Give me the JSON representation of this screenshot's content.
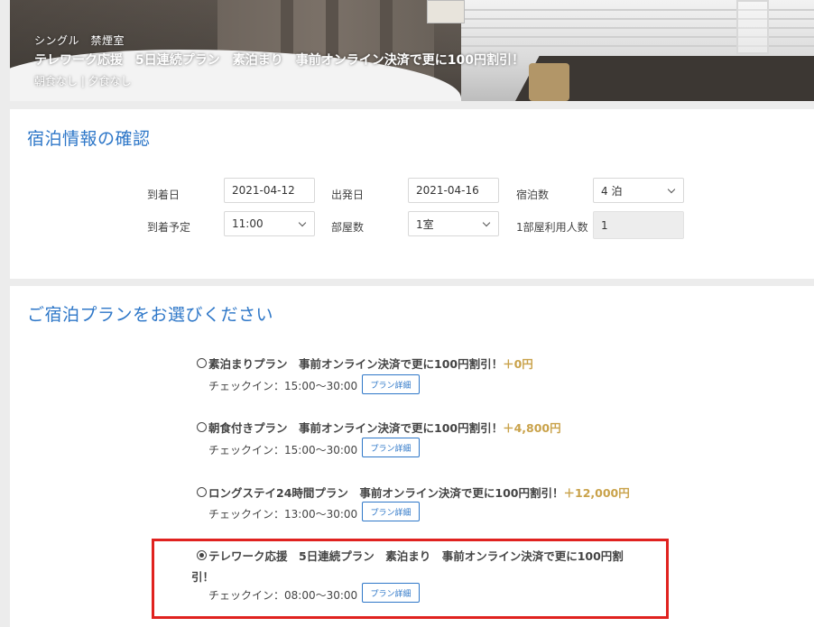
{
  "hero": {
    "room_type": "シングル　禁煙室",
    "plan_name": "テレワーク応援　5日連続プラン　素泊まり　事前オンライン決済で更に100円割引！",
    "meals": "朝食なし | 夕食なし"
  },
  "stay_info": {
    "title": "宿泊情報の確認",
    "arrival_date_label": "到着日",
    "arrival_date_value": "2021-04-12",
    "departure_date_label": "出発日",
    "departure_date_value": "2021-04-16",
    "nights_label": "宿泊数",
    "nights_value": "4 泊",
    "arrival_time_label": "到着予定",
    "arrival_time_value": "11:00",
    "rooms_label": "部屋数",
    "rooms_value": "1室",
    "guests_label": "1部屋利用人数",
    "guests_value": "1"
  },
  "plan_select": {
    "title": "ご宿泊プランをお選びください",
    "detail_label": "プラン詳細",
    "plans": [
      {
        "name": "素泊まりプラン　事前オンライン決済で更に100円割引！",
        "price": "＋0円",
        "checkin": "チェックイン：15:00～30:00",
        "selected": false
      },
      {
        "name": "朝食付きプラン　事前オンライン決済で更に100円割引！",
        "price": "＋4,800円",
        "checkin": "チェックイン：15:00～30:00",
        "selected": false
      },
      {
        "name": "ロングステイ24時間プラン　事前オンライン決済で更に100円割引！",
        "price": "＋12,000円",
        "checkin": "チェックイン：13:00～30:00",
        "selected": false
      },
      {
        "name_line1": "テレワーク応援　5日連続プラン　素泊まり　事前オンライン決済で更に100円割",
        "name_line2": "引！",
        "checkin": "チェックイン：08:00～30:00",
        "selected": true
      }
    ]
  },
  "colors": {
    "accent": "#2e77c8",
    "price": "#c9a24a",
    "highlight": "#e0221f"
  }
}
